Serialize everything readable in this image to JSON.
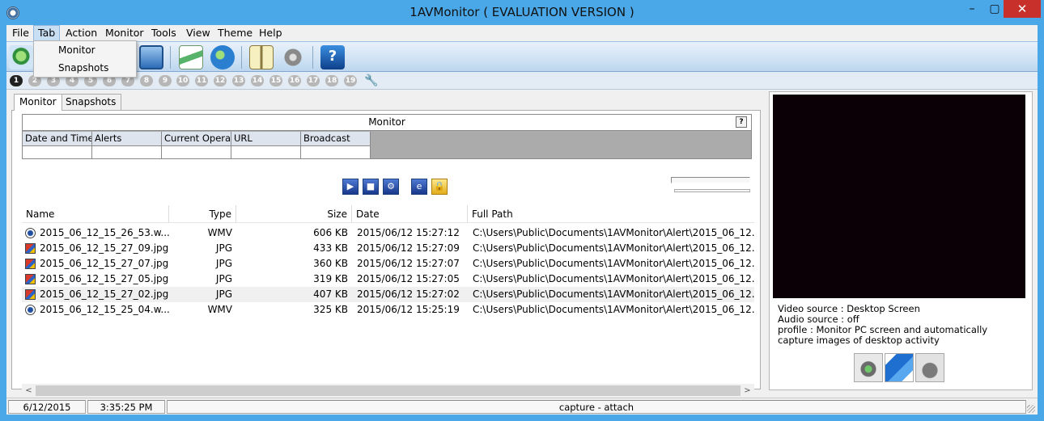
{
  "window": {
    "title": "1AVMonitor ( EVALUATION VERSION )",
    "minimize": "–",
    "maximize": "▢",
    "close": "✕"
  },
  "menu": [
    "File",
    "Tab",
    "Action",
    "Monitor",
    "Tools",
    "View",
    "Theme",
    "Help"
  ],
  "menu_open": {
    "Tab": [
      "Monitor",
      "Snapshots"
    ]
  },
  "tab_numbers": [
    "1",
    "2",
    "3",
    "4",
    "5",
    "6",
    "7",
    "8",
    "9",
    "10",
    "11",
    "12",
    "13",
    "14",
    "15",
    "16",
    "17",
    "18",
    "19"
  ],
  "panel_tabs": [
    "Monitor",
    "Snapshots"
  ],
  "monitor_grid": {
    "title": "Monitor",
    "help": "?",
    "columns": [
      "Date and Time",
      "Alerts",
      "Current Opera",
      "URL",
      "Broadcast"
    ]
  },
  "controls": {
    "play": "▶",
    "stop": "■",
    "wrench": "⚙",
    "ie": "e",
    "lock": "🔒"
  },
  "file_list": {
    "columns": [
      "Name",
      "Type",
      "Size",
      "Date",
      "Full Path"
    ],
    "rows": [
      {
        "name": "2015_06_12_15_26_53.w...",
        "type": "WMV",
        "size": "606 KB",
        "date": "2015/06/12 15:27:12",
        "path": "C:\\Users\\Public\\Documents\\1AVMonitor\\Alert\\2015_06_12...",
        "icon": "wmv-file-icon"
      },
      {
        "name": "2015_06_12_15_27_09.jpg",
        "type": "JPG",
        "size": "433 KB",
        "date": "2015/06/12 15:27:09",
        "path": "C:\\Users\\Public\\Documents\\1AVMonitor\\Alert\\2015_06_12...",
        "icon": "jpg-file-icon"
      },
      {
        "name": "2015_06_12_15_27_07.jpg",
        "type": "JPG",
        "size": "360 KB",
        "date": "2015/06/12 15:27:07",
        "path": "C:\\Users\\Public\\Documents\\1AVMonitor\\Alert\\2015_06_12...",
        "icon": "jpg-file-icon"
      },
      {
        "name": "2015_06_12_15_27_05.jpg",
        "type": "JPG",
        "size": "319 KB",
        "date": "2015/06/12 15:27:05",
        "path": "C:\\Users\\Public\\Documents\\1AVMonitor\\Alert\\2015_06_12...",
        "icon": "jpg-file-icon"
      },
      {
        "name": "2015_06_12_15_27_02.jpg",
        "type": "JPG",
        "size": "407 KB",
        "date": "2015/06/12 15:27:02",
        "path": "C:\\Users\\Public\\Documents\\1AVMonitor\\Alert\\2015_06_12...",
        "icon": "jpg-file-icon"
      },
      {
        "name": "2015_06_12_15_25_04.w...",
        "type": "WMV",
        "size": "325 KB",
        "date": "2015/06/12 15:25:19",
        "path": "C:\\Users\\Public\\Documents\\1AVMonitor\\Alert\\2015_06_12...",
        "icon": "wmv-file-icon"
      }
    ]
  },
  "scroll": {
    "left": "<",
    "right": ">"
  },
  "preview": {
    "video_source": "Video source : Desktop Screen",
    "audio_source": "Audio source : off",
    "profile_line1": "profile : Monitor PC screen and automatically",
    "profile_line2": "capture images of desktop activity"
  },
  "status": {
    "date": "6/12/2015",
    "time": "3:35:25 PM",
    "message": "capture - attach"
  },
  "colors": {
    "titlebar": "#4aa8e8",
    "close": "#c7302b",
    "video": "#0a0006"
  }
}
